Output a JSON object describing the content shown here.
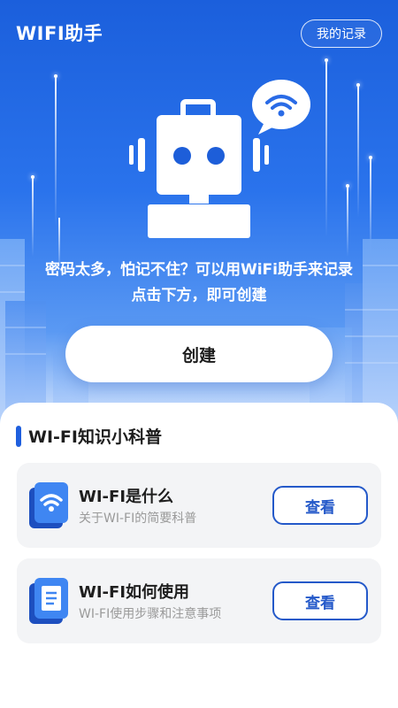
{
  "header": {
    "title": "WIFI助手",
    "records_button": "我的记录"
  },
  "hero": {
    "line1": "密码太多，怕记不住？可以用WiFi助手来记录",
    "line2": "点击下方，即可创建",
    "illustration": "robot-with-wifi-bubble",
    "create_button": "创建"
  },
  "knowledge": {
    "title": "WI-FI知识小科普",
    "items": [
      {
        "title": "WI-FI是什么",
        "subtitle": "关于WI-FI的简要科普",
        "icon": "wifi-icon",
        "button": "查看"
      },
      {
        "title": "WI-FI如何使用",
        "subtitle": "WI-FI使用步骤和注意事项",
        "icon": "document-icon",
        "button": "查看"
      }
    ]
  },
  "colors": {
    "primary": "#1f5fde",
    "hero_top": "#1b5fdc",
    "card_bg": "#f3f4f6",
    "button_border": "#2459c9"
  }
}
